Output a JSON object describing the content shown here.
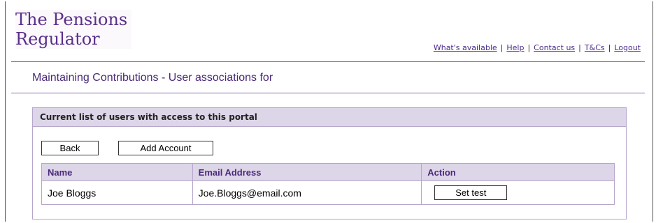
{
  "header": {
    "logo_line1": "The Pensions",
    "logo_line2": "Regulator",
    "links": [
      "What's available",
      "Help",
      "Contact us",
      "T&Cs",
      "Logout"
    ],
    "separator": "|"
  },
  "page": {
    "title": "Maintaining Contributions - User associations for"
  },
  "panel": {
    "heading": "Current list of users with access to this portal",
    "back_label": "Back",
    "add_account_label": "Add Account"
  },
  "table": {
    "columns": [
      "Name",
      "Email Address",
      "Action"
    ],
    "rows": [
      {
        "name": "Joe Bloggs",
        "email": "Joe.Bloggs@email.com",
        "action_label": "Set test"
      }
    ]
  },
  "colors": {
    "brand_purple": "#5a2f8a",
    "header_bg": "#ddd5e8",
    "border": "#b7a6cc"
  }
}
